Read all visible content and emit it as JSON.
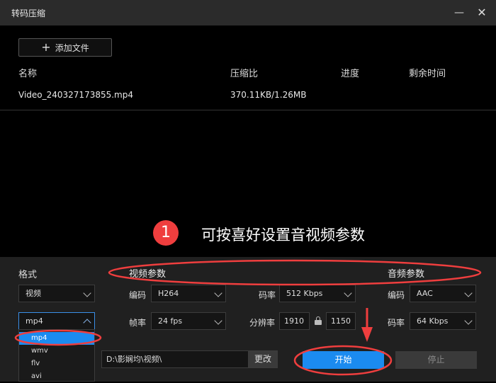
{
  "window": {
    "title": "转码压缩",
    "minimize": "—",
    "close": "✕"
  },
  "toolbar": {
    "add_file_label": "添加文件",
    "add_icon": "+"
  },
  "table": {
    "headers": [
      "名称",
      "压缩比",
      "进度",
      "剩余时间"
    ],
    "rows": [
      {
        "name": "Video_240327173855.mp4",
        "ratio": "370.11KB/1.26MB",
        "progress": "",
        "remaining": ""
      }
    ]
  },
  "annotation": {
    "badge": "1",
    "text": "可按喜好设置音视频参数",
    "color": "#ef3e3e"
  },
  "format": {
    "label": "格式",
    "category_value": "视频",
    "container_value": "mp4",
    "options": [
      "mp4",
      "wmv",
      "flv",
      "avi"
    ]
  },
  "video": {
    "title": "视频参数",
    "codec_label": "编码",
    "codec_value": "H264",
    "framerate_label": "帧率",
    "framerate_value": "24 fps",
    "bitrate_label": "码率",
    "bitrate_value": "512 Kbps",
    "resolution_label": "分辨率",
    "width": "1910",
    "height": "1150"
  },
  "audio": {
    "title": "音频参数",
    "codec_label": "编码",
    "codec_value": "AAC",
    "bitrate_label": "码率",
    "bitrate_value": "64 Kbps"
  },
  "output": {
    "path": "D:\\影娴均\\视频\\",
    "change_label": "更改"
  },
  "actions": {
    "start_label": "开始",
    "stop_label": "停止"
  },
  "colors": {
    "accent": "#1b8bf0",
    "panel": "#202020",
    "annotation": "#ef3e3e"
  }
}
